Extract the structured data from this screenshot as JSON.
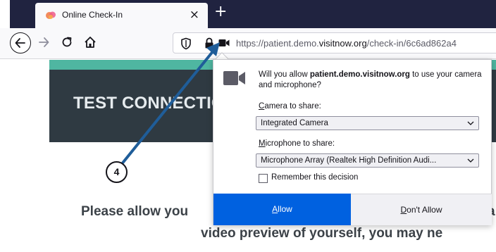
{
  "browser": {
    "tab": {
      "title": "Online Check-In",
      "close_glyph": "×"
    },
    "new_tab_glyph": "+",
    "url": {
      "prefix": "https://patient.demo.",
      "domain": "visitnow.org",
      "suffix": "/check-in/6c6ad862a4"
    }
  },
  "page": {
    "banner_title": "TEST CONNECTION",
    "message_line1": "Please allow you",
    "message_line1_tail": "a",
    "message_line2": "video preview of yourself, you may ne"
  },
  "popup": {
    "question_prefix": "Will you allow ",
    "question_domain": "patient.demo.visitnow.org",
    "question_suffix": " to use your camera and microphone?",
    "camera_label_key": "C",
    "camera_label_rest": "amera to share:",
    "camera_selected": "Integrated Camera",
    "mic_label_key": "M",
    "mic_label_rest": "icrophone to share:",
    "mic_selected": "Microphone Array (Realtek High Definition Audi...",
    "remember_label": "Remember this decision",
    "allow_key": "A",
    "allow_rest": "llow",
    "dont_key": "D",
    "dont_rest": "on't Allow"
  },
  "annotation": {
    "step_number": "4"
  },
  "colors": {
    "accent": "#4fb6a1",
    "banner": "#2f3a42",
    "allow_button": "#0061e0",
    "annotation_arrow": "#1f5d99"
  },
  "icons": [
    "firefox-favicon",
    "back-arrow-icon",
    "forward-arrow-icon",
    "reload-icon",
    "home-icon",
    "shield-icon",
    "lock-icon",
    "camera-icon",
    "chevron-down-icon"
  ]
}
